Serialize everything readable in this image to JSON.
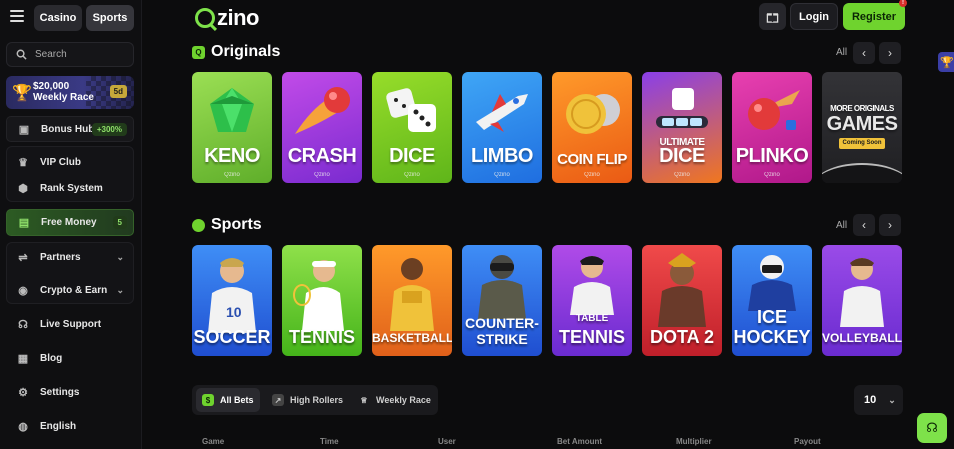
{
  "brand": {
    "logo_text": "zino",
    "accent": "#6fd32e"
  },
  "header": {
    "casino_tab": "Casino",
    "sports_tab": "Sports",
    "login": "Login",
    "register": "Register",
    "register_badge": "!"
  },
  "sidebar": {
    "search_placeholder": "Search",
    "race": {
      "amount": "$20,000",
      "label": "Weekly Race",
      "badge": "5d"
    },
    "items": [
      {
        "label": "Bonus Hub",
        "pill": "+300%",
        "icon": "gift-icon"
      },
      {
        "label": "VIP Club",
        "icon": "crown-icon"
      },
      {
        "label": "Rank System",
        "icon": "shield-icon"
      },
      {
        "label": "Free Money",
        "pill": "5",
        "icon": "money-icon"
      },
      {
        "label": "Partners",
        "icon": "handshake-icon"
      },
      {
        "label": "Crypto & Earn",
        "icon": "coin-icon"
      },
      {
        "label": "Live Support",
        "icon": "headset-icon"
      },
      {
        "label": "Blog",
        "icon": "blog-icon"
      },
      {
        "label": "Settings",
        "icon": "gear-icon"
      },
      {
        "label": "English",
        "icon": "globe-icon"
      }
    ]
  },
  "originals": {
    "title": "Originals",
    "all": "All",
    "games": [
      {
        "name": "KENO",
        "provider": "Qzino",
        "color": "#7ecb3f"
      },
      {
        "name": "CRASH",
        "provider": "Qzino",
        "color": "#a53fd8"
      },
      {
        "name": "DICE",
        "provider": "Qzino",
        "color": "#7ccb1f"
      },
      {
        "name": "LIMBO",
        "provider": "Qzino",
        "color": "#2f8df0"
      },
      {
        "name": "COIN FLIP",
        "provider": "Qzino",
        "color": "#f07a1e"
      },
      {
        "name": "ULTIMATE",
        "name2": "DICE",
        "provider": "Qzino",
        "color": "#8a3fe8"
      },
      {
        "name": "PLINKO",
        "provider": "Qzino",
        "color": "#d42c9c"
      },
      {
        "name": "MORE ORIGINALS",
        "name2": "GAMES",
        "badge": "Coming Soon",
        "color": "#2a2a2e"
      }
    ]
  },
  "sports": {
    "title": "Sports",
    "all": "All",
    "items": [
      {
        "name": "SOCCER",
        "color": "#2f6ee8"
      },
      {
        "name": "TENNIS",
        "color": "#5fcf2a"
      },
      {
        "name": "BASKETBALL",
        "color": "#f0771e"
      },
      {
        "name": "COUNTER-",
        "name2": "STRIKE",
        "color": "#2a7af0"
      },
      {
        "name": "TABLE",
        "name2": "TENNIS",
        "color": "#9a3fe8"
      },
      {
        "name": "DOTA 2",
        "color": "#e83a3a"
      },
      {
        "name": "ICE",
        "name2": "HOCKEY",
        "color": "#2b7ae8"
      },
      {
        "name": "VOLLEYBALL",
        "color": "#8a3fe8"
      }
    ]
  },
  "bets": {
    "tabs": [
      "All Bets",
      "High Rollers",
      "Weekly Race"
    ],
    "count": "10",
    "columns": [
      "Game",
      "Time",
      "User",
      "Bet Amount",
      "Multiplier",
      "Payout"
    ]
  }
}
